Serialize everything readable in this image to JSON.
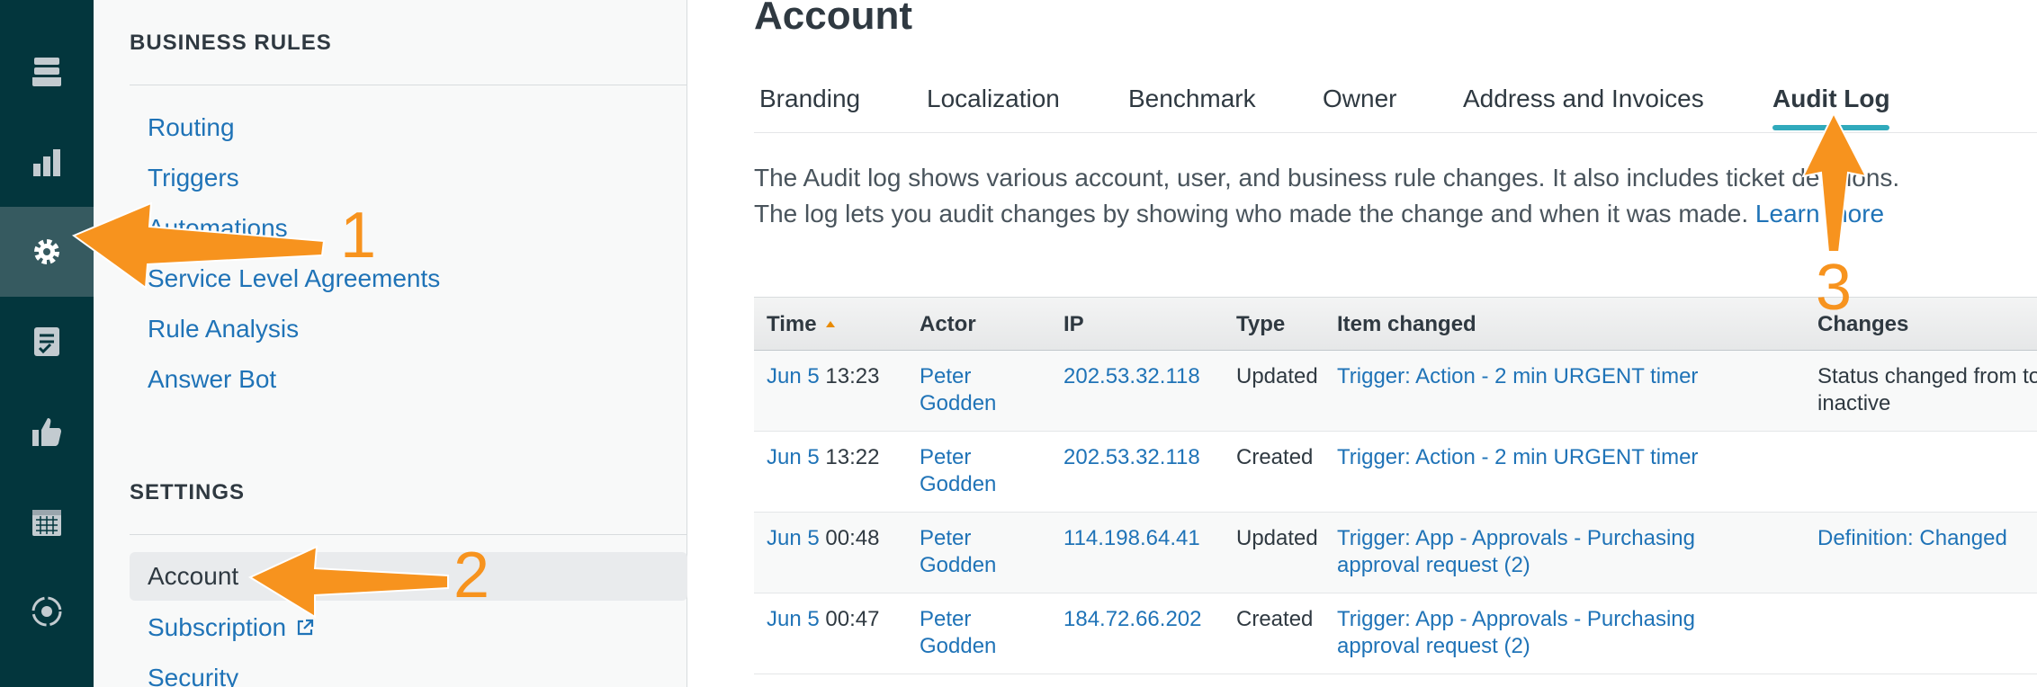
{
  "rail": {
    "items": [
      {
        "icon": "views-icon",
        "active": false
      },
      {
        "icon": "reporting-icon",
        "active": false
      },
      {
        "icon": "settings-gear-icon",
        "active": true
      },
      {
        "icon": "checklist-icon",
        "active": false
      },
      {
        "icon": "thumbs-up-icon",
        "active": false
      },
      {
        "icon": "calendar-icon",
        "active": false
      },
      {
        "icon": "sync-icon",
        "active": false
      }
    ]
  },
  "subnav": {
    "business_rules_title": "BUSINESS RULES",
    "business_rules": [
      "Routing",
      "Triggers",
      "Automations",
      "Service Level Agreements",
      "Rule Analysis",
      "Answer Bot"
    ],
    "settings_title": "SETTINGS",
    "settings": [
      "Account",
      "Subscription",
      "Security"
    ]
  },
  "main": {
    "title": "Account",
    "tabs": [
      "Branding",
      "Localization",
      "Benchmark",
      "Owner",
      "Address and Invoices",
      "Audit Log"
    ],
    "active_tab": "Audit Log",
    "description_line1": "The Audit log shows various account, user, and business rule changes. It also includes ticket deletions.",
    "description_line2": "The log lets you audit changes by showing who made the change and when it was made.",
    "learn_more": "Learn more"
  },
  "table": {
    "headers": [
      "Time",
      "Actor",
      "IP",
      "Type",
      "Item changed",
      "Changes"
    ],
    "rows": [
      {
        "date": "Jun 5",
        "time": "13:23",
        "actor": "Peter Godden",
        "ip": "202.53.32.118",
        "type": "Updated",
        "item": "Trigger: Action - 2 min URGENT timer",
        "changes": "Status changed from to inactive"
      },
      {
        "date": "Jun 5",
        "time": "13:22",
        "actor": "Peter Godden",
        "ip": "202.53.32.118",
        "type": "Created",
        "item": "Trigger: Action - 2 min URGENT timer",
        "changes": ""
      },
      {
        "date": "Jun 5",
        "time": "00:48",
        "actor": "Peter Godden",
        "ip": "114.198.64.41",
        "type": "Updated",
        "item": "Trigger: App - Approvals - Purchasing approval request (2)",
        "changes": "Definition: Changed"
      },
      {
        "date": "Jun 5",
        "time": "00:47",
        "actor": "Peter Godden",
        "ip": "184.72.66.202",
        "type": "Created",
        "item": "Trigger: App - Approvals - Purchasing approval request (2)",
        "changes": ""
      }
    ]
  },
  "annotations": {
    "labels": [
      "1",
      "2",
      "3"
    ],
    "color": "#f7931e"
  },
  "colors": {
    "rail": "#03363d",
    "link": "#1f73b7",
    "tab_underline": "#30aabc",
    "annotation": "#f7931e"
  }
}
